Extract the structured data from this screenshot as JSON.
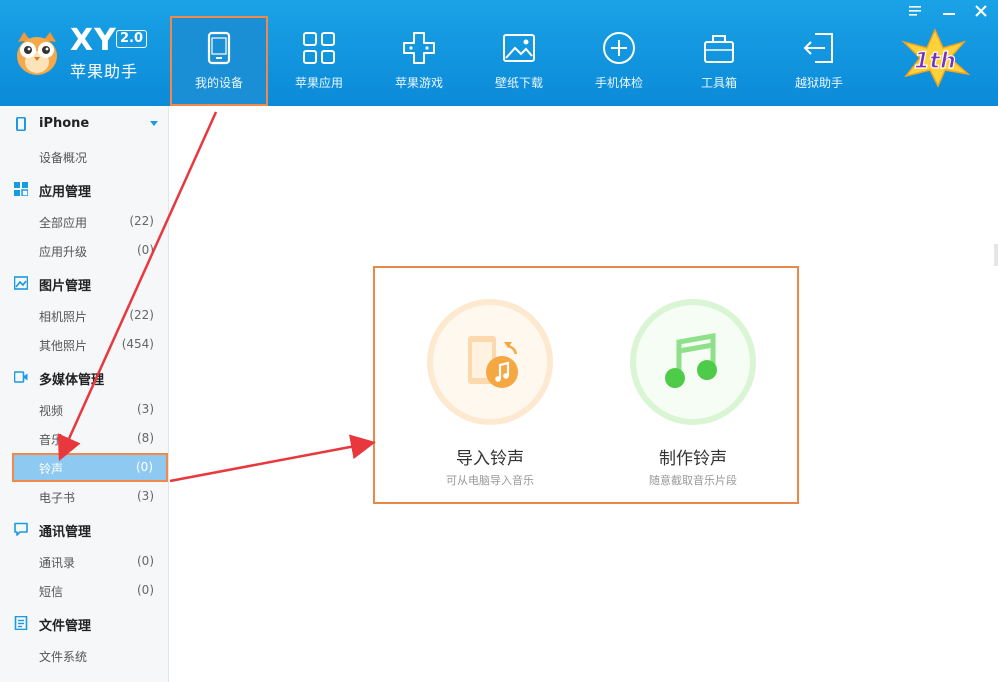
{
  "app": {
    "brand_short": "XY",
    "brand_version": "2.0",
    "brand_name": "苹果助手",
    "badge_text": "1th"
  },
  "window_controls": {
    "menu_icon": "menu-icon",
    "minimize_icon": "minimize-icon",
    "close_icon": "close-icon"
  },
  "nav": [
    {
      "label": "我的设备",
      "icon": "tablet-icon",
      "active": true
    },
    {
      "label": "苹果应用",
      "icon": "grid-icon",
      "active": false
    },
    {
      "label": "苹果游戏",
      "icon": "gamepad-icon",
      "active": false
    },
    {
      "label": "壁纸下载",
      "icon": "picture-icon",
      "active": false
    },
    {
      "label": "手机体检",
      "icon": "plus-circle-icon",
      "active": false
    },
    {
      "label": "工具箱",
      "icon": "toolbox-icon",
      "active": false
    },
    {
      "label": "越狱助手",
      "icon": "exit-arrow-icon",
      "active": false
    }
  ],
  "sidebar": {
    "groups": [
      {
        "title": "iPhone",
        "icon": "phone-icon",
        "items": [
          {
            "label": "设备概况",
            "count": ""
          }
        ]
      },
      {
        "title": "应用管理",
        "icon": "apps-icon",
        "items": [
          {
            "label": "全部应用",
            "count": "(22)"
          },
          {
            "label": "应用升级",
            "count": "(0)"
          }
        ]
      },
      {
        "title": "图片管理",
        "icon": "image-icon",
        "items": [
          {
            "label": "相机照片",
            "count": "(22)"
          },
          {
            "label": "其他照片",
            "count": "(454)"
          }
        ]
      },
      {
        "title": "多媒体管理",
        "icon": "video-icon",
        "items": [
          {
            "label": "视频",
            "count": "(3)"
          },
          {
            "label": "音乐",
            "count": "(8)"
          },
          {
            "label": "铃声",
            "count": "(0)"
          },
          {
            "label": "电子书",
            "count": "(3)"
          }
        ]
      },
      {
        "title": "通讯管理",
        "icon": "chat-icon",
        "items": [
          {
            "label": "通讯录",
            "count": "(0)"
          },
          {
            "label": "短信",
            "count": "(0)"
          }
        ]
      },
      {
        "title": "文件管理",
        "icon": "file-icon",
        "items": [
          {
            "label": "文件系统",
            "count": ""
          }
        ]
      }
    ]
  },
  "main": {
    "import": {
      "title": "导入铃声",
      "subtitle": "可从电脑导入音乐",
      "icon": "import-ringtone-icon"
    },
    "make": {
      "title": "制作铃声",
      "subtitle": "随意截取音乐片段",
      "icon": "music-note-icon"
    }
  },
  "colors": {
    "header_top": "#1aa2e6",
    "header_bottom": "#0b8ad8",
    "highlight_border": "#f0894a",
    "annotation_arrow": "#e8383d",
    "import_accent": "#f5a742",
    "make_accent": "#5fcf55"
  }
}
